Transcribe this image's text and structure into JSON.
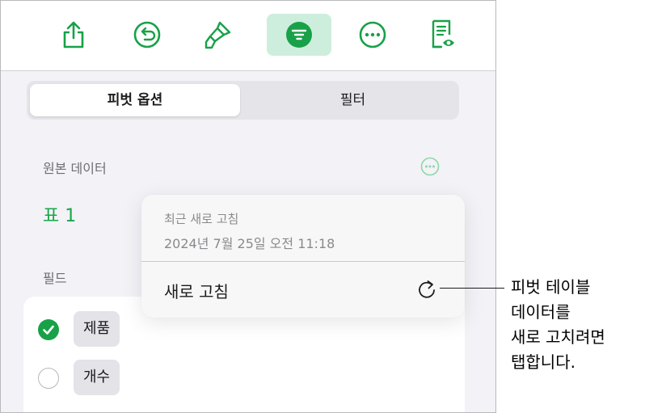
{
  "toolbar": {
    "buttons": [
      {
        "icon": "share-icon"
      },
      {
        "icon": "undo-icon"
      },
      {
        "icon": "format-brush-icon"
      },
      {
        "icon": "organize-icon",
        "active": true
      },
      {
        "icon": "more-icon"
      },
      {
        "icon": "document-view-icon"
      }
    ]
  },
  "segmented": {
    "pivot_options": "피벗 옵션",
    "filter": "필터"
  },
  "source": {
    "label": "원본 데이터",
    "table_name": "표 1"
  },
  "fields": {
    "label": "필드",
    "items": [
      {
        "name": "제품",
        "checked": true
      },
      {
        "name": "개수",
        "checked": false
      }
    ]
  },
  "popover": {
    "caption": "최근 새로 고침",
    "date": "2024년 7월 25일 오전 11:18",
    "action": "새로 고침"
  },
  "callout": {
    "lines": [
      "피벗 테이블",
      "데이터를",
      "새로 고치려면",
      "탭합니다."
    ]
  },
  "colors": {
    "accent": "#18a148",
    "active_tab_bg": "#cdeedd"
  }
}
